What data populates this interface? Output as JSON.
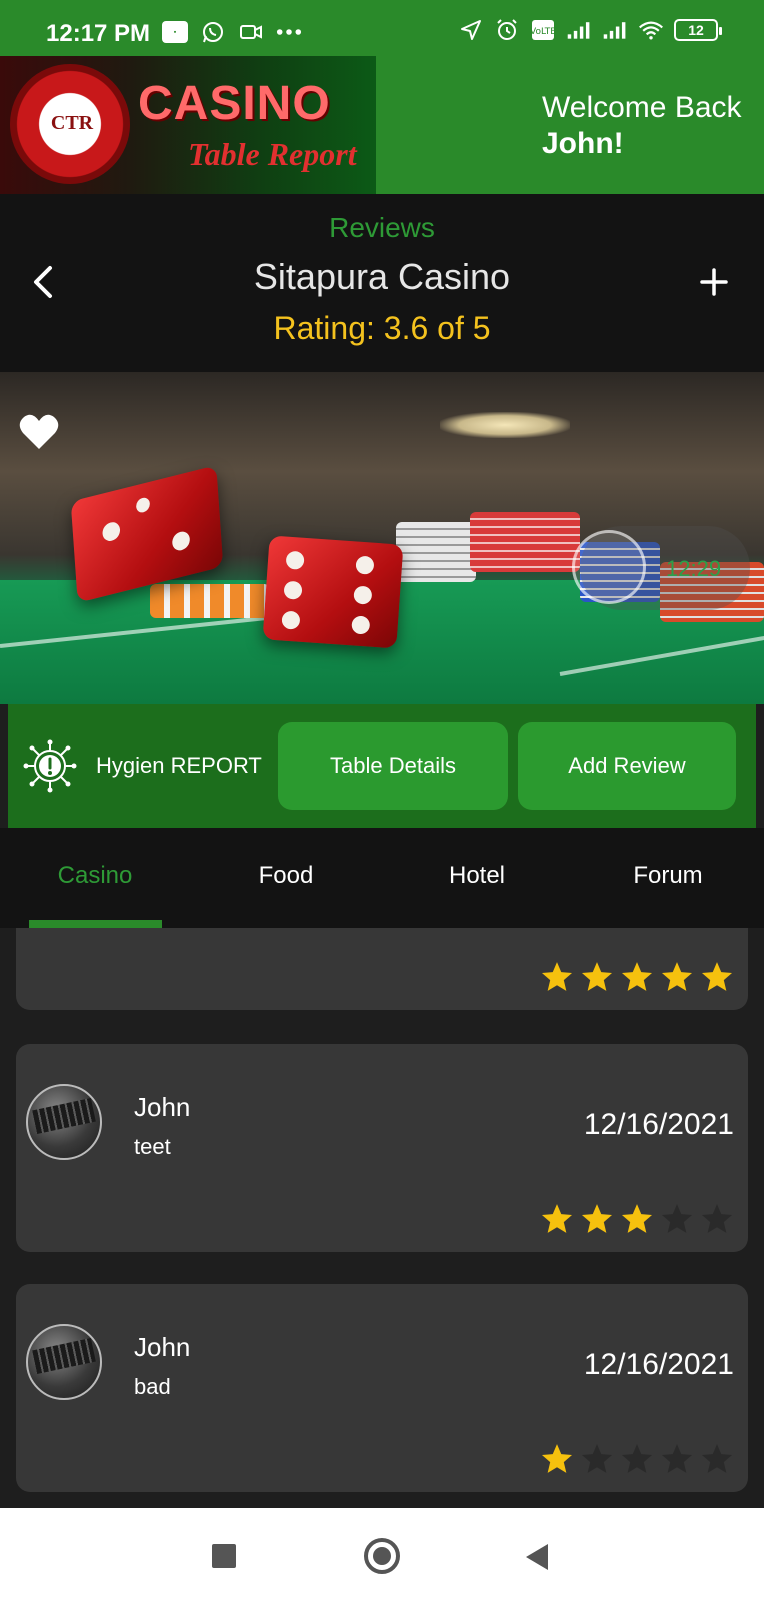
{
  "status_bar": {
    "time": "12:17 PM",
    "battery": "12",
    "left_icons": [
      "app-icon",
      "whatsapp-icon",
      "video-icon",
      "more-icon"
    ],
    "right_icons": [
      "location-icon",
      "alarm-icon",
      "volte-icon",
      "signal-icon",
      "signal-icon",
      "wifi-icon",
      "battery-icon"
    ]
  },
  "header": {
    "logo_chip": "CTR",
    "logo_casino": "CASINO",
    "logo_table_report": "Table Report",
    "welcome_line": "Welcome Back",
    "welcome_name": "John!",
    "brand_color": "#2a8a2a"
  },
  "title_block": {
    "section": "Reviews",
    "venue_name": "Sitapura Casino",
    "rating": "Rating: 3.6 of 5",
    "back_icon": "chevron-left-icon",
    "add_icon": "plus-icon"
  },
  "hero": {
    "favorite_icon": "heart-icon",
    "timer": "12:29"
  },
  "actions": {
    "hygiene_label": "Hygien REPORT",
    "hygiene_icon": "virus-alert-icon",
    "table_details_label": "Table Details",
    "add_review_label": "Add Review"
  },
  "tabs": [
    {
      "label": "Casino",
      "active": true
    },
    {
      "label": "Food",
      "active": false
    },
    {
      "label": "Hotel",
      "active": false
    },
    {
      "label": "Forum",
      "active": false
    }
  ],
  "reviews": [
    {
      "name": "",
      "text": "",
      "date": "",
      "stars": 5
    },
    {
      "name": "John",
      "text": "teet",
      "date": "12/16/2021",
      "stars": 3
    },
    {
      "name": "John",
      "text": "bad",
      "date": "12/16/2021",
      "stars": 1
    }
  ],
  "colors": {
    "star_filled": "#f6c10e",
    "star_empty": "#2a2a2a",
    "accent_green": "#2e9a36",
    "rating_yellow": "#f4c21e"
  },
  "nav_bar": {
    "icons": [
      "recent-apps-icon",
      "home-icon",
      "back-icon"
    ]
  }
}
